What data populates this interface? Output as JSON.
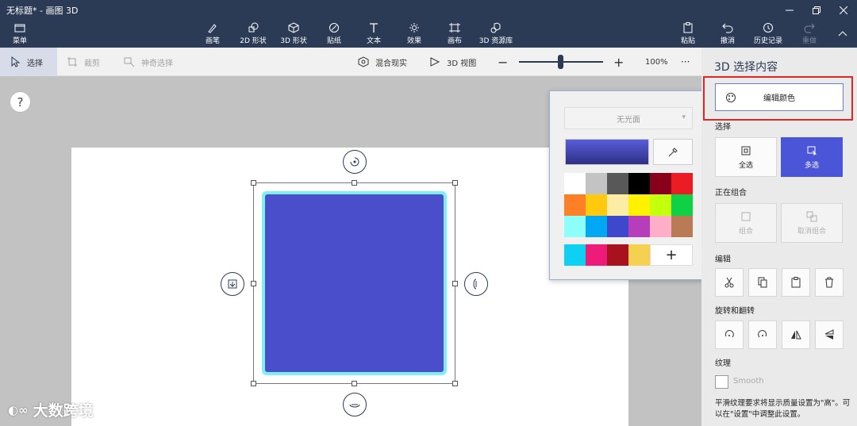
{
  "window": {
    "title": "无标题* - 画图 3D",
    "minimize_icon": "minimize-icon",
    "maximize_icon": "restore-icon",
    "close_icon": "close-icon"
  },
  "ribbon": {
    "menu_label": "菜单",
    "tools": [
      {
        "label": "画笔",
        "icon": "brush-icon"
      },
      {
        "label": "2D 形状",
        "icon": "2d-shapes-icon"
      },
      {
        "label": "3D 形状",
        "icon": "3d-shapes-icon"
      },
      {
        "label": "贴纸",
        "icon": "stickers-icon"
      },
      {
        "label": "文本",
        "icon": "text-icon"
      },
      {
        "label": "效果",
        "icon": "effects-icon"
      },
      {
        "label": "画布",
        "icon": "canvas-icon"
      },
      {
        "label": "3D 资源库",
        "icon": "3d-library-icon"
      }
    ],
    "right_actions": [
      {
        "label": "粘贴",
        "icon": "paste-icon"
      },
      {
        "label": "撤消",
        "icon": "undo-icon"
      },
      {
        "label": "历史记录",
        "icon": "history-icon"
      },
      {
        "label": "重做",
        "icon": "redo-icon"
      }
    ],
    "collapse_icon": "chevron-up-icon"
  },
  "subbar": {
    "select": "选择",
    "crop": "裁剪",
    "magic_select": "神奇选择",
    "mixed_reality": "混合现实",
    "view_3d": "3D 视图",
    "zoom_out": "−",
    "zoom_in": "+",
    "zoom_level": "100%",
    "zoom_value": 0.5,
    "more": "···"
  },
  "canvas": {
    "help": "?",
    "shape_color": "#4b4ecb",
    "glow_color": "#7ef0f5"
  },
  "color_popup": {
    "material": "无光面",
    "current_color": "#4b4ecb",
    "palette": [
      "#ffffff",
      "#c3c3c3",
      "#585858",
      "#000000",
      "#88001b",
      "#ec1c24",
      "#ff7f27",
      "#ffc90e",
      "#fdeca6",
      "#fff200",
      "#c4ff0e",
      "#0ed145",
      "#8cfffb",
      "#00a8f3",
      "#3f48cc",
      "#b83dba",
      "#ffaec8",
      "#b97a56"
    ],
    "recent": [
      "#0ed0f3",
      "#ec1c78",
      "#a8121e",
      "#f6d050"
    ],
    "add_label": "+"
  },
  "panel": {
    "title": "3D 选择内容",
    "edit_color": "编辑颜色",
    "select_label": "选择",
    "select_all": "全选",
    "multi_select": "多选",
    "grouping_label": "正在组合",
    "group": "组合",
    "ungroup": "取消组合",
    "edit_label": "编辑",
    "rotate_flip_label": "旋转和翻转",
    "texture_label": "纹理",
    "smooth": "Smooth",
    "note": "平滑纹理要求将显示质量设置为\"高\"。可以在\"设置\"中调整此设置。"
  },
  "watermark": {
    "text": "大数跨境"
  }
}
